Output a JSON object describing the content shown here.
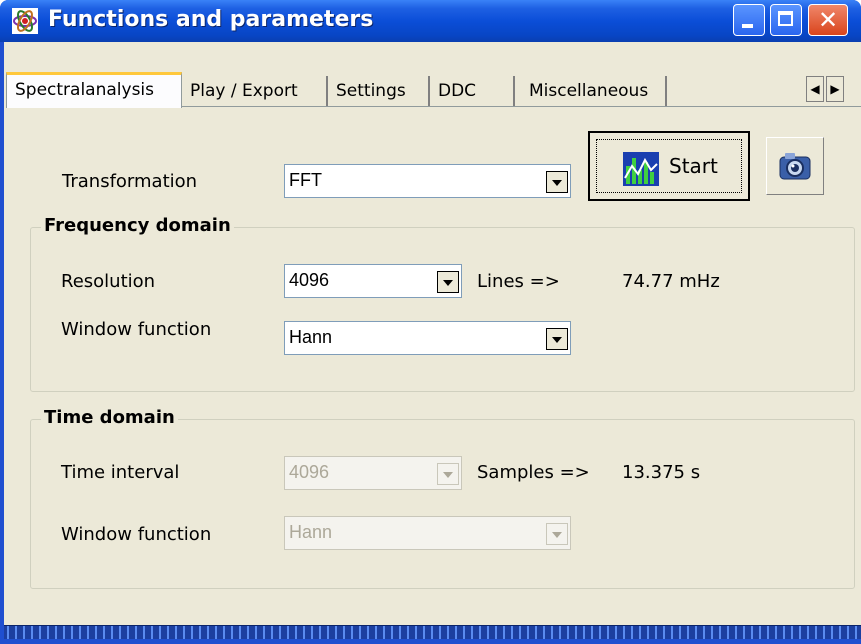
{
  "window": {
    "title": "Functions and parameters"
  },
  "tabs": [
    {
      "label": "Spectralanalysis",
      "active": true
    },
    {
      "label": "Play / Export",
      "active": false
    },
    {
      "label": "Settings",
      "active": false
    },
    {
      "label": "DDC",
      "active": false
    },
    {
      "label": "Miscellaneous",
      "active": false
    }
  ],
  "transformation": {
    "label": "Transformation",
    "value": "FFT"
  },
  "start_button": {
    "label": "Start"
  },
  "frequency_domain": {
    "title": "Frequency domain",
    "resolution_label": "Resolution",
    "resolution_value": "4096",
    "lines_label": "Lines =>",
    "lines_result": "74.77 mHz",
    "window_label": "Window function",
    "window_value": "Hann"
  },
  "time_domain": {
    "title": "Time domain",
    "interval_label": "Time interval",
    "interval_value": "4096",
    "samples_label": "Samples =>",
    "samples_result": "13.375 s",
    "window_label": "Window function",
    "window_value": "Hann",
    "enabled": false
  },
  "icons": {
    "app": "spectrum-app-icon",
    "start": "spectrum-chart-icon",
    "snapshot": "camera-icon",
    "tab_scroll_left": "arrow-left-icon",
    "tab_scroll_right": "arrow-right-icon"
  },
  "colors": {
    "titlebar": "#0b4ed8",
    "face": "#ece9d8",
    "active_tab_accent": "#ffc83c",
    "close": "#d9441c"
  }
}
